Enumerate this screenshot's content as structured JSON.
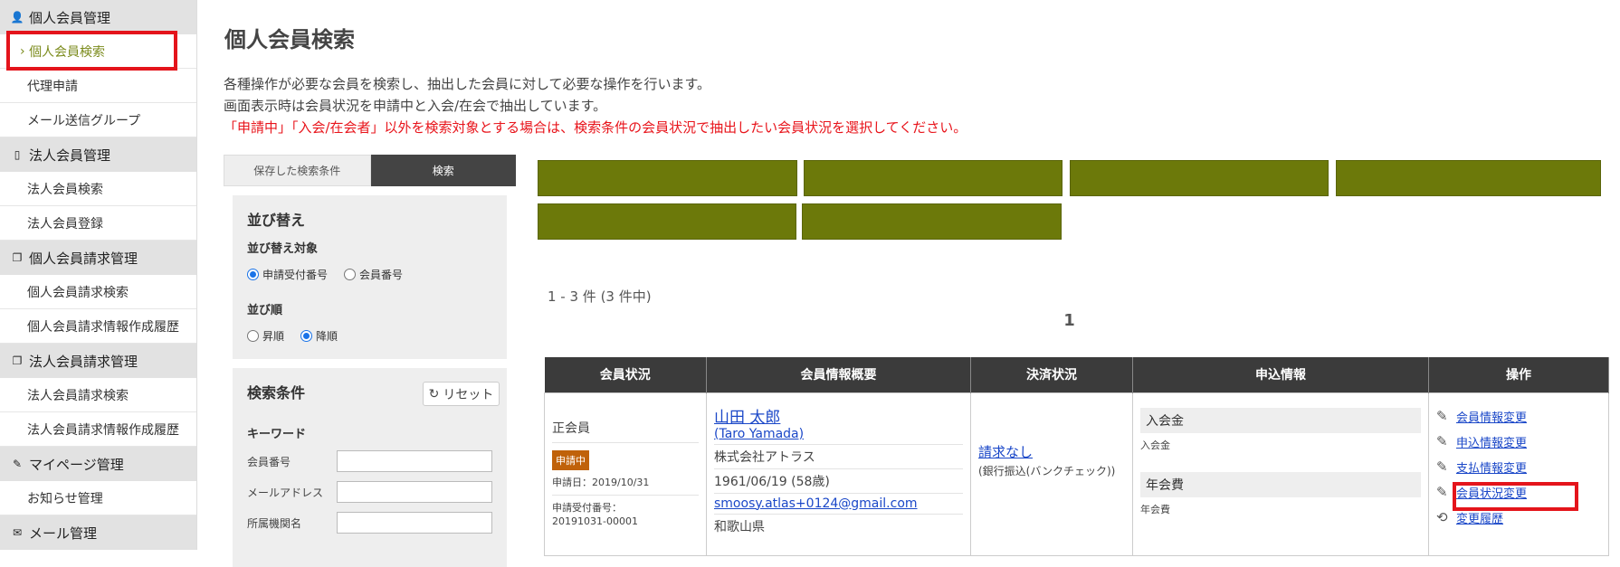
{
  "sidebar": {
    "sec1": "個人会員管理",
    "sec1_items": [
      "個人会員検索",
      "代理申請",
      "メール送信グループ"
    ],
    "sec2": "法人会員管理",
    "sec2_items": [
      "法人会員検索",
      "法人会員登録"
    ],
    "sec3": "個人会員請求管理",
    "sec3_items": [
      "個人会員請求検索",
      "個人会員請求情報作成履歴"
    ],
    "sec4": "法人会員請求管理",
    "sec4_items": [
      "法人会員請求検索",
      "法人会員請求情報作成履歴"
    ],
    "sec5": "マイページ管理",
    "sec5_items": [
      "お知らせ管理"
    ],
    "sec6": "メール管理"
  },
  "page": {
    "title": "個人会員検索",
    "desc1": "各種操作が必要な会員を検索し、抽出した会員に対して必要な操作を行います。",
    "desc2": "画面表示時は会員状況を申請中と入会/在会で抽出しています。",
    "desc3": "「申請中」「入会/在会者」以外を検索対象とする場合は、検索条件の会員状況で抽出したい会員状況を選択してください。"
  },
  "panel": {
    "tab_saved": "保存した検索条件",
    "tab_search": "検索",
    "sort_title": "並び替え",
    "sort_target": "並び替え対象",
    "opt_app": "申請受付番号",
    "opt_member": "会員番号",
    "sort_order": "並び順",
    "opt_asc": "昇順",
    "opt_desc": "降順",
    "cond_title": "検索条件",
    "reset": "リセット",
    "keyword": "キーワード",
    "f_member": "会員番号",
    "f_mail": "メールアドレス",
    "f_org": "所属機関名"
  },
  "results": {
    "count": "1 - 3 件 (3 件中)",
    "page": "1",
    "headers": [
      "会員状況",
      "会員情報概要",
      "決済状況",
      "申込情報",
      "操作"
    ],
    "row": {
      "status": "正会員",
      "badge": "申請中",
      "app_date": "申請日：2019/10/31",
      "app_no_label": "申請受付番号：",
      "app_no": "20191031-00001",
      "name": "山田 太郎",
      "name_en": "(Taro Yamada)",
      "company": "株式会社アトラス",
      "birth": "1961/06/19 (58歳)",
      "email": "smoosy.atlas+0124@gmail.com",
      "pref": "和歌山県",
      "payment": "請求なし",
      "payment_method": "(銀行振込(バンクチェック))",
      "fee1": "入会金",
      "fee1_sub": "入会金",
      "fee2": "年会費",
      "fee2_sub": "年会費",
      "ops": [
        "会員情報変更",
        "申込情報変更",
        "支払情報変更",
        "会員状況変更",
        "変更履歴"
      ]
    }
  },
  "colors": {
    "accent": "#6c790a",
    "highlight": "#e4141b",
    "link": "#1a47c8",
    "badge": "#c0620a"
  }
}
